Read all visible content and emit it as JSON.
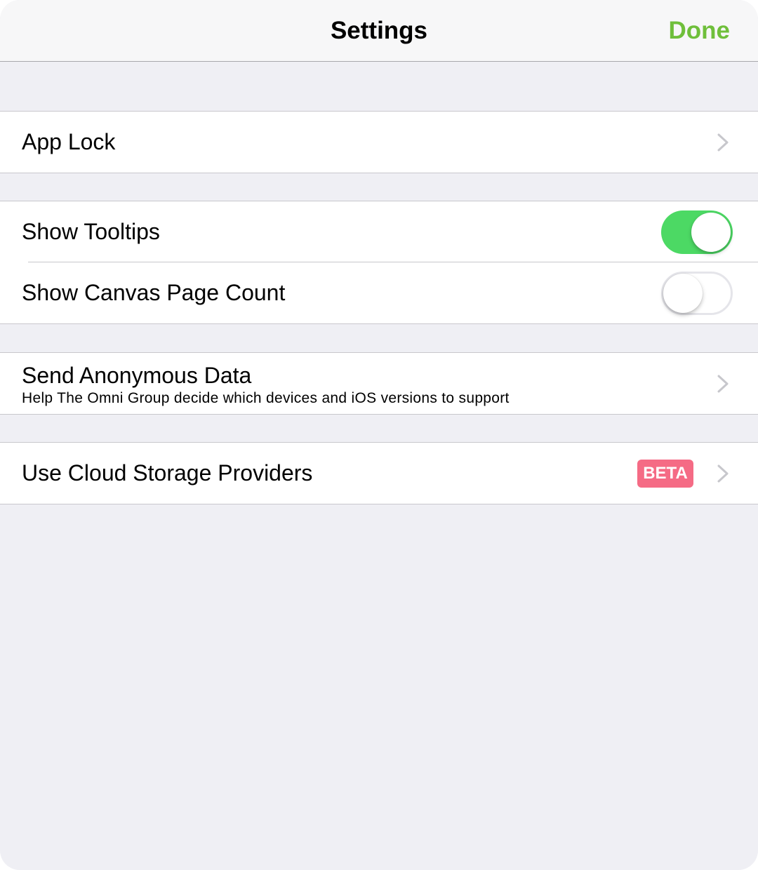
{
  "navbar": {
    "title": "Settings",
    "done_label": "Done"
  },
  "sections": {
    "app_lock": {
      "label": "App Lock"
    },
    "show_tooltips": {
      "label": "Show Tooltips",
      "enabled": true
    },
    "show_canvas_page_count": {
      "label": "Show Canvas Page Count",
      "enabled": false
    },
    "send_anonymous_data": {
      "label": "Send Anonymous Data",
      "subtitle": "Help The Omni Group decide which devices and iOS versions to support"
    },
    "cloud_storage": {
      "label": "Use Cloud Storage Providers",
      "badge": "BETA"
    }
  },
  "colors": {
    "accent": "#6fbf3b",
    "toggle_on": "#4cd964",
    "badge": "#f56b85",
    "background": "#efeff4"
  }
}
